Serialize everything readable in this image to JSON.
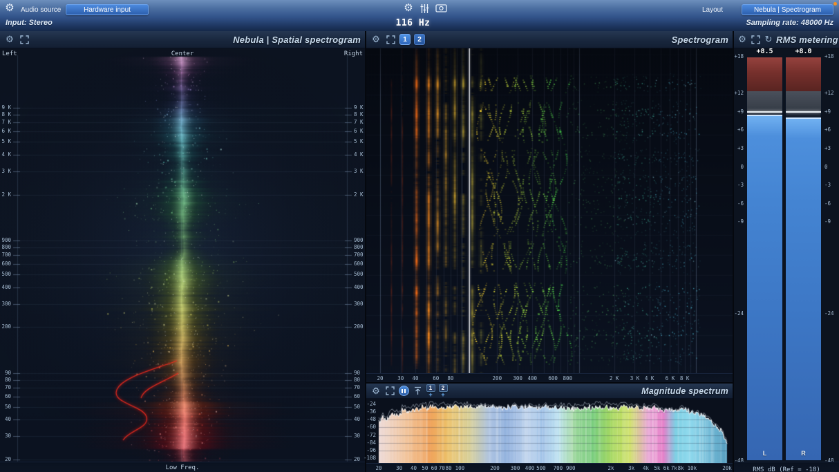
{
  "icons": {
    "gear": "⚙",
    "refresh": "↻",
    "plus": "+"
  },
  "topbar": {
    "audio_source_label": "Audio source",
    "hardware_input_button": "Hardware input",
    "input_status": "Input: Stereo",
    "frequency_readout": "116 Hz",
    "layout_button": "Layout",
    "view_button": "Nebula | Spectrogram",
    "sampling_rate": "Sampling rate: 48000 Hz"
  },
  "spatial": {
    "title": "Nebula | Spatial spectrogram",
    "pan_left": "Left",
    "pan_center": "Center",
    "pan_right": "Right",
    "bottom_label": "Low Freq.",
    "freq_ticks": [
      {
        "label": "9 K",
        "f": 9000
      },
      {
        "label": "8 K",
        "f": 8000
      },
      {
        "label": "7 K",
        "f": 7000
      },
      {
        "label": "6 K",
        "f": 6000
      },
      {
        "label": "5 K",
        "f": 5000
      },
      {
        "label": "4 K",
        "f": 4000
      },
      {
        "label": "3 K",
        "f": 3000
      },
      {
        "label": "2 K",
        "f": 2000
      },
      {
        "label": "900",
        "f": 900
      },
      {
        "label": "800",
        "f": 800
      },
      {
        "label": "700",
        "f": 700
      },
      {
        "label": "600",
        "f": 600
      },
      {
        "label": "500",
        "f": 500
      },
      {
        "label": "400",
        "f": 400
      },
      {
        "label": "300",
        "f": 300
      },
      {
        "label": "200",
        "f": 200
      },
      {
        "label": "90",
        "f": 90
      },
      {
        "label": "80",
        "f": 80
      },
      {
        "label": "70",
        "f": 70
      },
      {
        "label": "60",
        "f": 60
      },
      {
        "label": "50",
        "f": 50
      },
      {
        "label": "40",
        "f": 40
      },
      {
        "label": "30",
        "f": 30
      },
      {
        "label": "20",
        "f": 20
      }
    ]
  },
  "spectrogram": {
    "title": "Spectrogram",
    "view_buttons": [
      "1",
      "2"
    ],
    "cursor_freq_hz": 116,
    "freq_ticks": [
      {
        "label": "20",
        "f": 20
      },
      {
        "label": "30",
        "f": 30
      },
      {
        "label": "40",
        "f": 40
      },
      {
        "label": "60",
        "f": 60
      },
      {
        "label": "80",
        "f": 80
      },
      {
        "label": "200",
        "f": 200
      },
      {
        "label": "300",
        "f": 300
      },
      {
        "label": "400",
        "f": 400
      },
      {
        "label": "600",
        "f": 600
      },
      {
        "label": "800",
        "f": 800
      },
      {
        "label": "2 K",
        "f": 2000
      },
      {
        "label": "3 K",
        "f": 3000
      },
      {
        "label": "4 K",
        "f": 4000
      },
      {
        "label": "6 K",
        "f": 6000
      },
      {
        "label": "8 K",
        "f": 8000
      }
    ]
  },
  "magnitude": {
    "title": "Magnitude spectrum",
    "view_buttons": [
      "1",
      "2"
    ],
    "db_ticks": [
      {
        "label": "-24",
        "db": -24
      },
      {
        "label": "-36",
        "db": -36
      },
      {
        "label": "-48",
        "db": -48
      },
      {
        "label": "-60",
        "db": -60
      },
      {
        "label": "-72",
        "db": -72
      },
      {
        "label": "-84",
        "db": -84
      },
      {
        "label": "-96",
        "db": -96
      },
      {
        "label": "-108",
        "db": -108
      }
    ],
    "freq_ticks": [
      {
        "label": "20",
        "f": 20
      },
      {
        "label": "30",
        "f": 30
      },
      {
        "label": "40",
        "f": 40
      },
      {
        "label": "50",
        "f": 50
      },
      {
        "label": "60",
        "f": 60
      },
      {
        "label": "70",
        "f": 70
      },
      {
        "label": "80",
        "f": 80
      },
      {
        "label": "100",
        "f": 100
      },
      {
        "label": "200",
        "f": 200
      },
      {
        "label": "300",
        "f": 300
      },
      {
        "label": "400",
        "f": 400
      },
      {
        "label": "500",
        "f": 500
      },
      {
        "label": "700",
        "f": 700
      },
      {
        "label": "900",
        "f": 900
      },
      {
        "label": "2k",
        "f": 2000
      },
      {
        "label": "3k",
        "f": 3000
      },
      {
        "label": "4k",
        "f": 4000
      },
      {
        "label": "5k",
        "f": 5000
      },
      {
        "label": "6k",
        "f": 6000
      },
      {
        "label": "7k",
        "f": 7000
      },
      {
        "label": "8k",
        "f": 8000
      },
      {
        "label": "10k",
        "f": 10000
      },
      {
        "label": "20k",
        "f": 20000
      }
    ]
  },
  "rms": {
    "title": "RMS metering",
    "channels": [
      {
        "name": "L",
        "value_label": "+8.5",
        "value_db": 8.5
      },
      {
        "name": "R",
        "value_label": "+8.0",
        "value_db": 8.0
      }
    ],
    "scale_ticks": [
      {
        "label": "+18",
        "db": 18
      },
      {
        "label": "+12",
        "db": 12
      },
      {
        "label": "+9",
        "db": 9
      },
      {
        "label": "+6",
        "db": 6
      },
      {
        "label": "+3",
        "db": 3
      },
      {
        "label": "0",
        "db": 0
      },
      {
        "label": "-3",
        "db": -3
      },
      {
        "label": "-6",
        "db": -6
      },
      {
        "label": "-9",
        "db": -9
      },
      {
        "label": "-24",
        "db": -24
      },
      {
        "label": "-48",
        "db": -48
      }
    ],
    "scale_max_db": 18,
    "scale_min_db": -48,
    "red_zone_bottom_db": 12.5,
    "peak_line_db": 9.1,
    "footer": "RMS dB (Ref = -18)"
  }
}
